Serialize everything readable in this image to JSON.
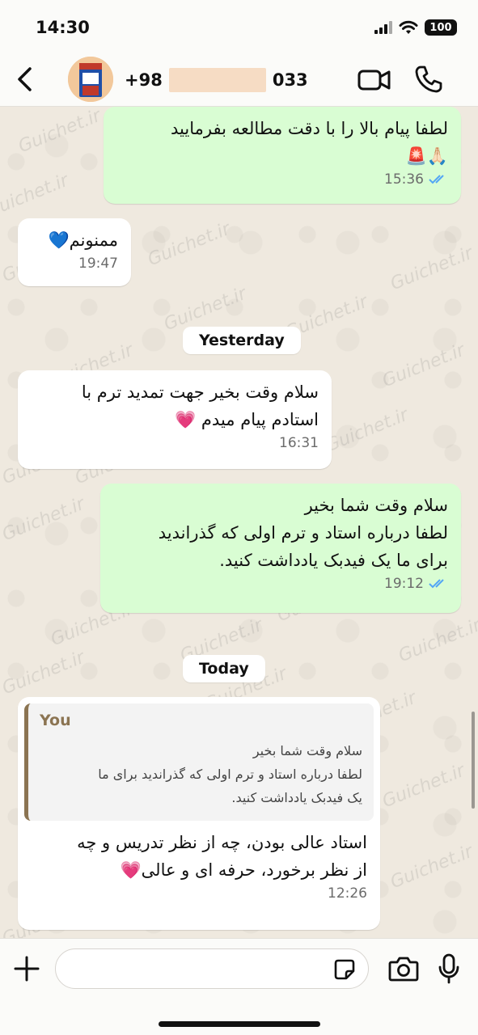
{
  "status_bar": {
    "time": "14:30",
    "battery": "100"
  },
  "header": {
    "name_prefix": "+98",
    "name_suffix": "033"
  },
  "watermark": "Guichet.ir",
  "messages": [
    {
      "direction": "out",
      "text": "لطفا پیام بالا را با دقت مطالعه بفرمایید\n🙏🏻🚨",
      "time": "15:36",
      "read": true
    },
    {
      "direction": "in",
      "text": "ممنونم💙",
      "time": "19:47"
    },
    {
      "direction": "in",
      "text": "سلام وقت بخیر جهت تمدید ترم با\nاستادم پیام میدم 💗",
      "time": "16:31"
    },
    {
      "direction": "out",
      "text": "سلام وقت شما بخیر\nلطفا درباره استاد و ترم اولی که گذراندید\nبرای ما یک فیدبک یادداشت کنید.",
      "time": "19:12",
      "read": true
    },
    {
      "direction": "in",
      "quote_author": "You",
      "quote_text": "سلام وقت شما بخیر\nلطفا درباره استاد و ترم اولی که گذراندید برای ما\nیک فیدبک یادداشت کنید.",
      "text": "استاد عالی بودن، چه از نظر تدریس و چه\nاز نظر برخورد، حرفه ای و عالی💗",
      "time": "12:26"
    }
  ],
  "date_separators": [
    "Yesterday",
    "Today"
  ],
  "input": {
    "placeholder": ""
  },
  "icons": {
    "back": "chevron-left-icon",
    "video": "video-camera-icon",
    "call": "phone-icon",
    "plus": "plus-icon",
    "sticker": "sticker-icon",
    "camera": "camera-icon",
    "mic": "microphone-icon",
    "read_receipt": "double-check-icon"
  },
  "colors": {
    "outgoing_bubble": "#d9fdd3",
    "incoming_bubble": "#ffffff",
    "read_tick": "#53a6f5",
    "quote_accent": "#8b7452"
  }
}
